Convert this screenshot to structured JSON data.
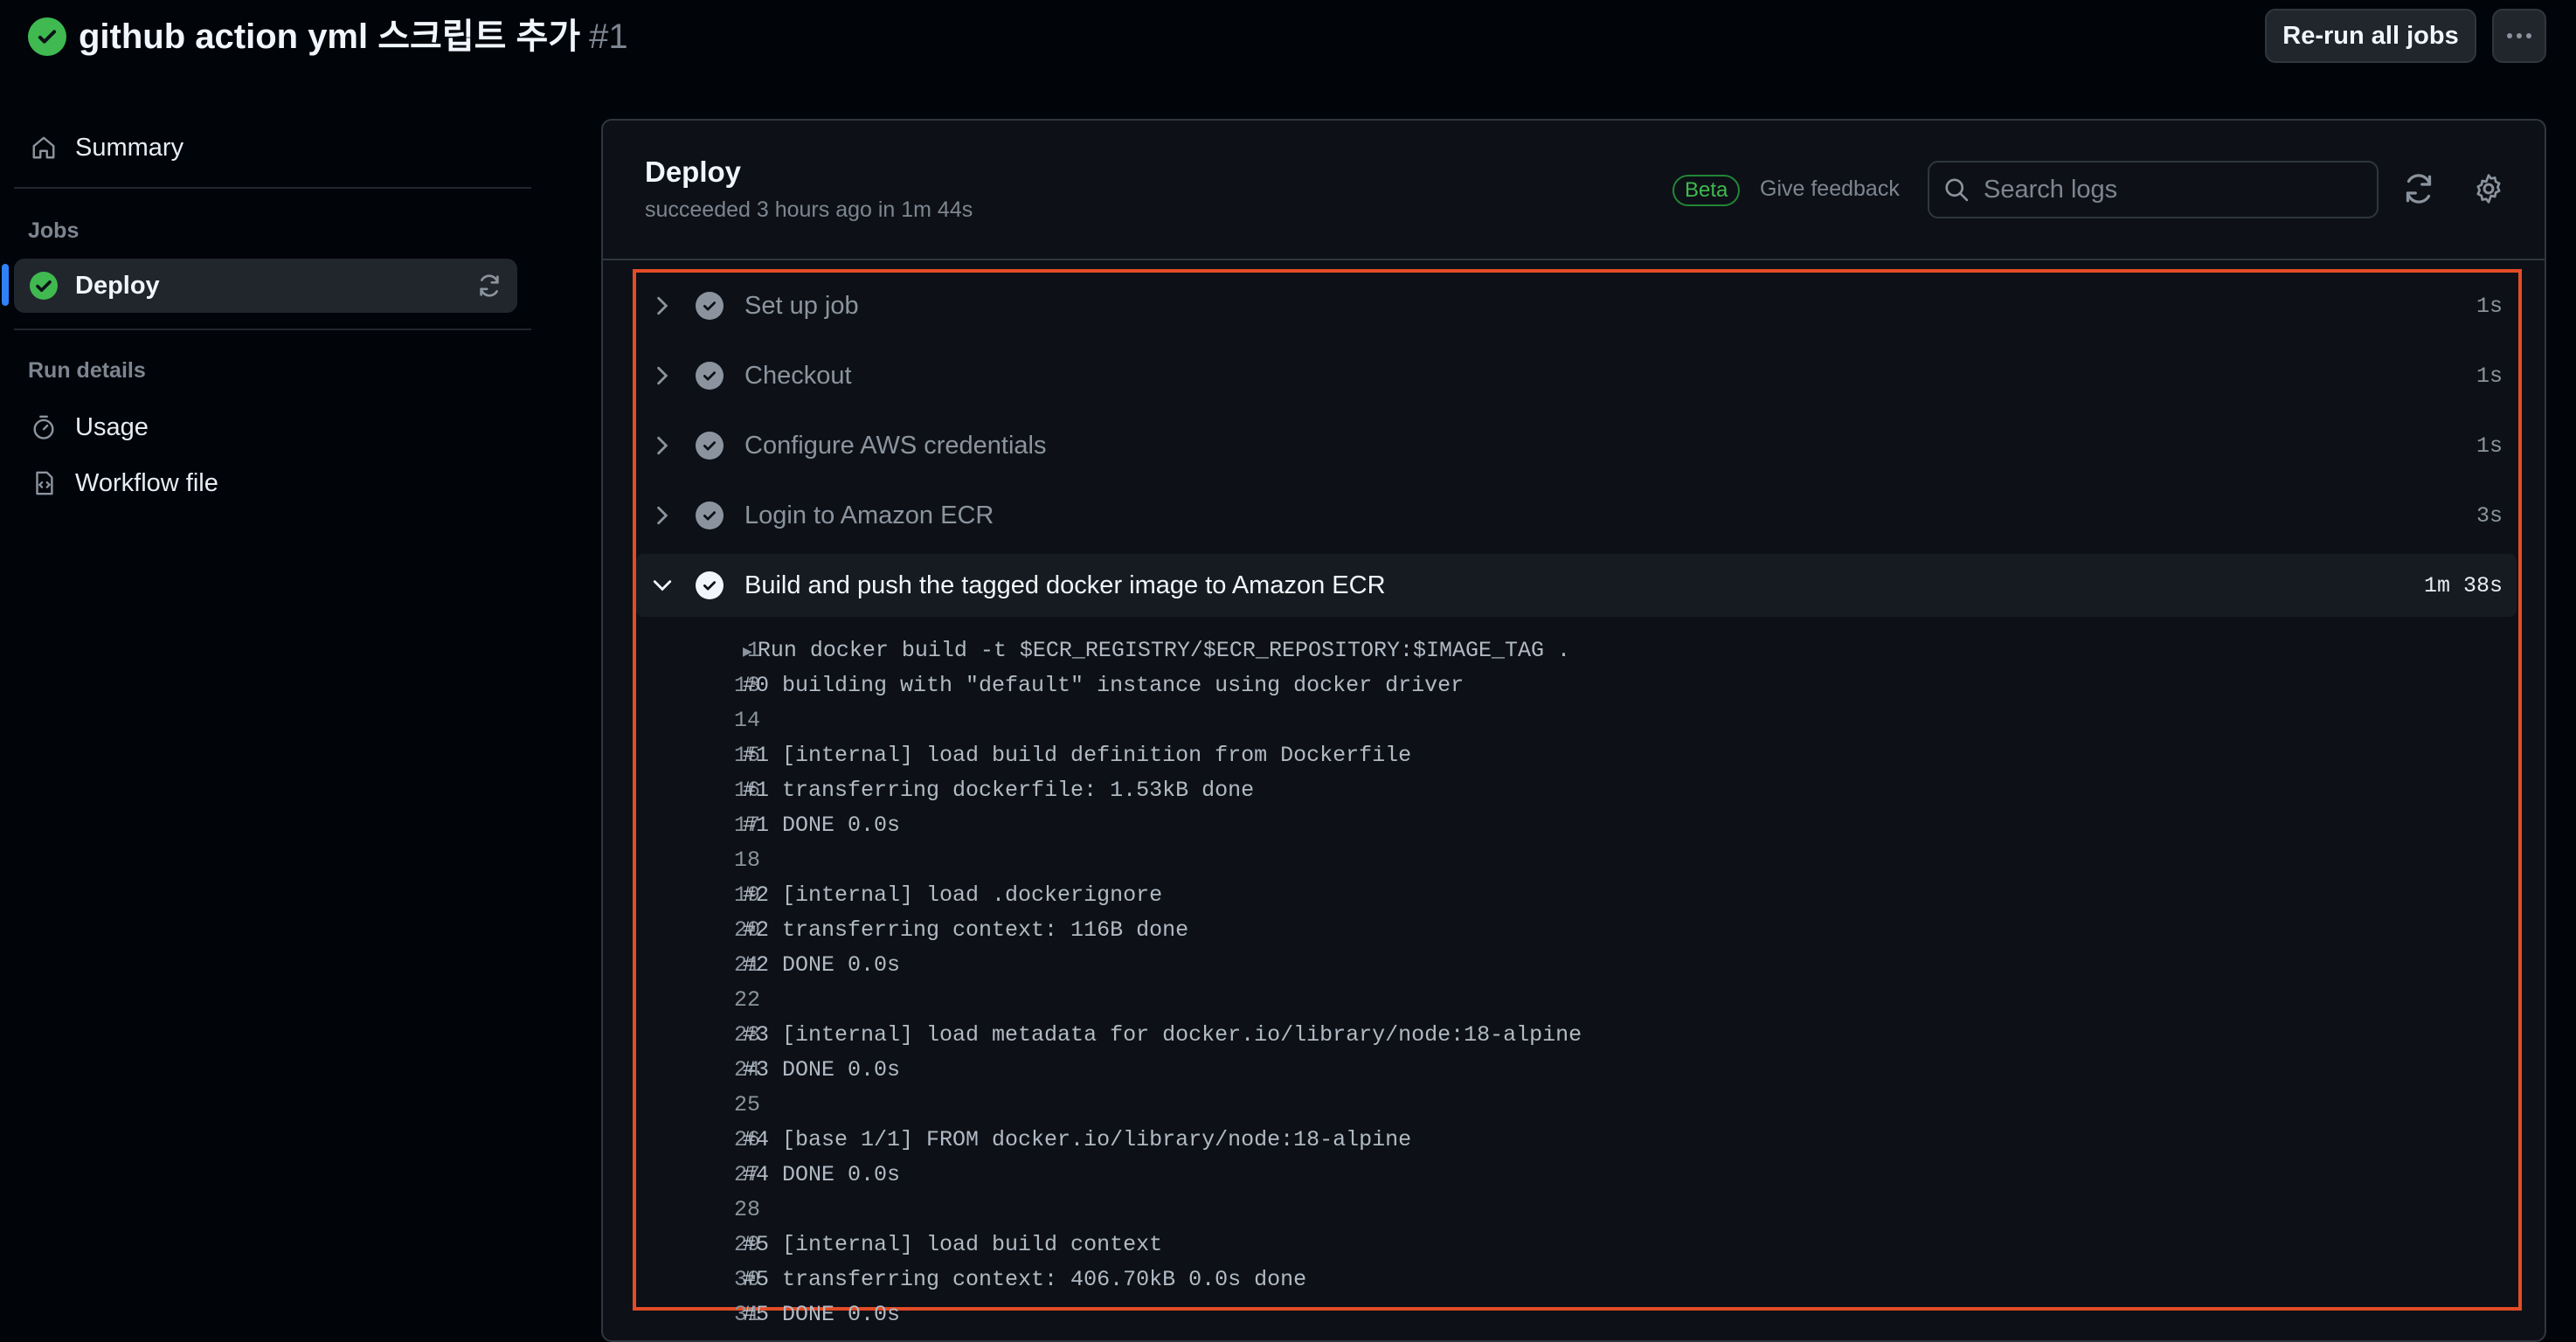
{
  "header": {
    "title": "github action yml 스크립트 추가",
    "run_number": "#1",
    "rerun_label": "Re-run all jobs",
    "more_label": "···"
  },
  "sidebar": {
    "summary_label": "Summary",
    "jobs_heading": "Jobs",
    "deploy_label": "Deploy",
    "run_details_heading": "Run details",
    "usage_label": "Usage",
    "workflow_file_label": "Workflow file"
  },
  "job": {
    "title": "Deploy",
    "status": "succeeded 3 hours ago in 1m 44s",
    "beta": "Beta",
    "feedback": "Give feedback",
    "search_placeholder": "Search logs"
  },
  "steps": [
    {
      "name": "Set up job",
      "duration": "1s"
    },
    {
      "name": "Checkout",
      "duration": "1s"
    },
    {
      "name": "Configure AWS credentials",
      "duration": "1s"
    },
    {
      "name": "Login to Amazon ECR",
      "duration": "3s"
    },
    {
      "name": "Build and push the tagged docker image to Amazon ECR",
      "duration": "1m 38s"
    }
  ],
  "log_lines": [
    {
      "n": "1",
      "text": "Run docker build -t $ECR_REGISTRY/$ECR_REPOSITORY:$IMAGE_TAG ."
    },
    {
      "n": "13",
      "text": "#0 building with \"default\" instance using docker driver"
    },
    {
      "n": "14",
      "text": ""
    },
    {
      "n": "15",
      "text": "#1 [internal] load build definition from Dockerfile"
    },
    {
      "n": "16",
      "text": "#1 transferring dockerfile: 1.53kB done"
    },
    {
      "n": "17",
      "text": "#1 DONE 0.0s"
    },
    {
      "n": "18",
      "text": ""
    },
    {
      "n": "19",
      "text": "#2 [internal] load .dockerignore"
    },
    {
      "n": "20",
      "text": "#2 transferring context: 116B done"
    },
    {
      "n": "21",
      "text": "#2 DONE 0.0s"
    },
    {
      "n": "22",
      "text": ""
    },
    {
      "n": "23",
      "text": "#3 [internal] load metadata for docker.io/library/node:18-alpine"
    },
    {
      "n": "24",
      "text": "#3 DONE 0.0s"
    },
    {
      "n": "25",
      "text": ""
    },
    {
      "n": "26",
      "text": "#4 [base 1/1] FROM docker.io/library/node:18-alpine"
    },
    {
      "n": "27",
      "text": "#4 DONE 0.0s"
    },
    {
      "n": "28",
      "text": ""
    },
    {
      "n": "29",
      "text": "#5 [internal] load build context"
    },
    {
      "n": "30",
      "text": "#5 transferring context: 406.70kB 0.0s done"
    },
    {
      "n": "31",
      "text": "#5 DONE 0.0s"
    }
  ],
  "colors": {
    "success": "#3fb950",
    "highlight_border": "#e34c26",
    "accent": "#2f81f7"
  }
}
